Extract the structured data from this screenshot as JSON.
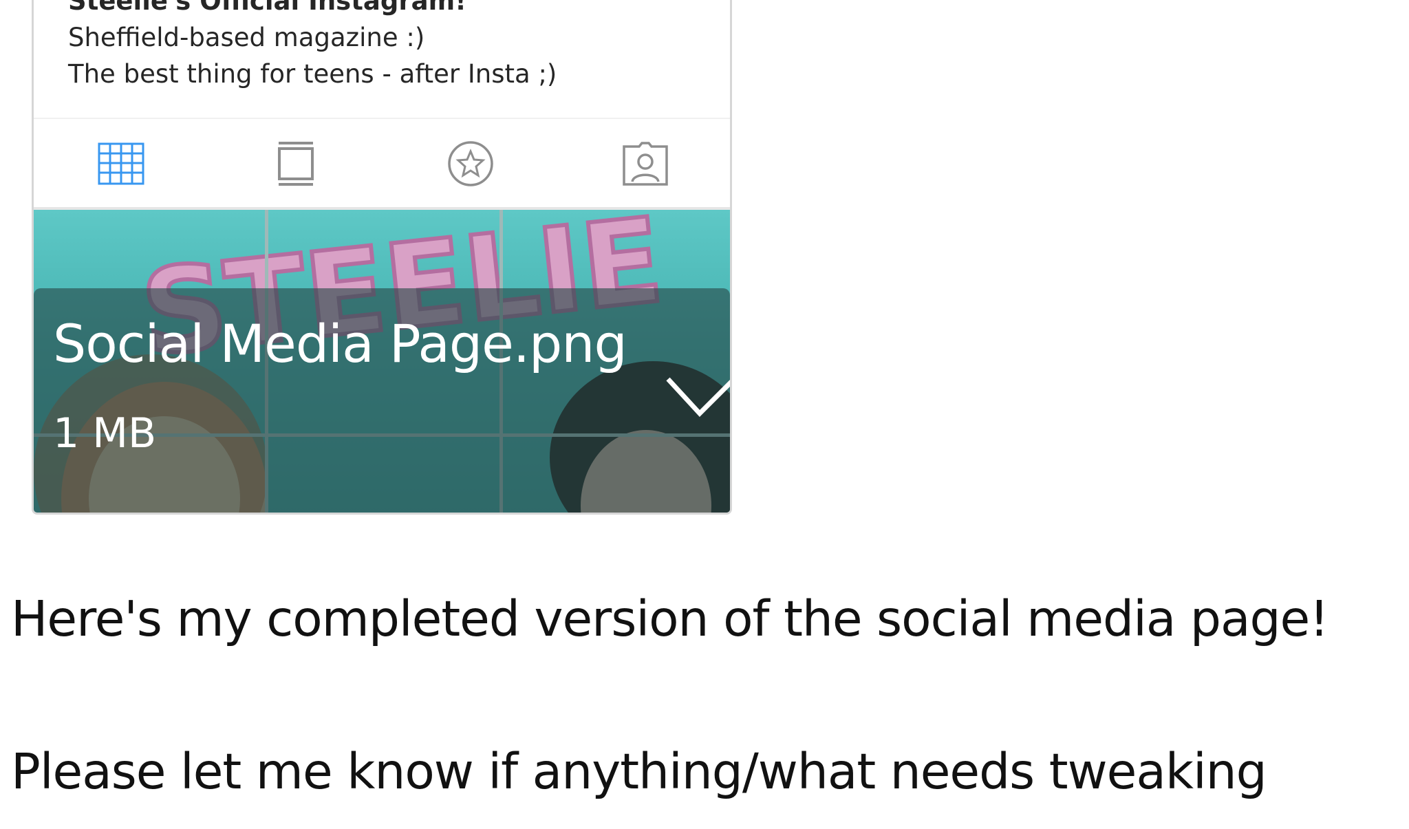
{
  "attachment": {
    "bio": {
      "name": "Steelie's Official Instagram!",
      "lines": [
        "Sheffield-based magazine :)",
        "The best thing for teens - after Insta ;)"
      ]
    },
    "tabs": [
      {
        "icon": "grid-icon",
        "active": true
      },
      {
        "icon": "igtv-icon",
        "active": false
      },
      {
        "icon": "star-circle-icon",
        "active": false
      },
      {
        "icon": "tagged-user-icon",
        "active": false
      }
    ],
    "preview_image_text": "STEELIE",
    "file_name": "Social Media Page.png",
    "file_size": "1 MB",
    "selected_icon": "checkmark-icon"
  },
  "message": {
    "line1": "Here's my completed version of the social media page!",
    "line2": "Please let me know if anything/what needs tweaking"
  },
  "colors": {
    "active_tab": "#3897f0",
    "inactive_tab": "#8e8e8e",
    "teal_background": "#45b2b0",
    "logo_pink": "#d9a1c6",
    "overlay": "#284848"
  }
}
